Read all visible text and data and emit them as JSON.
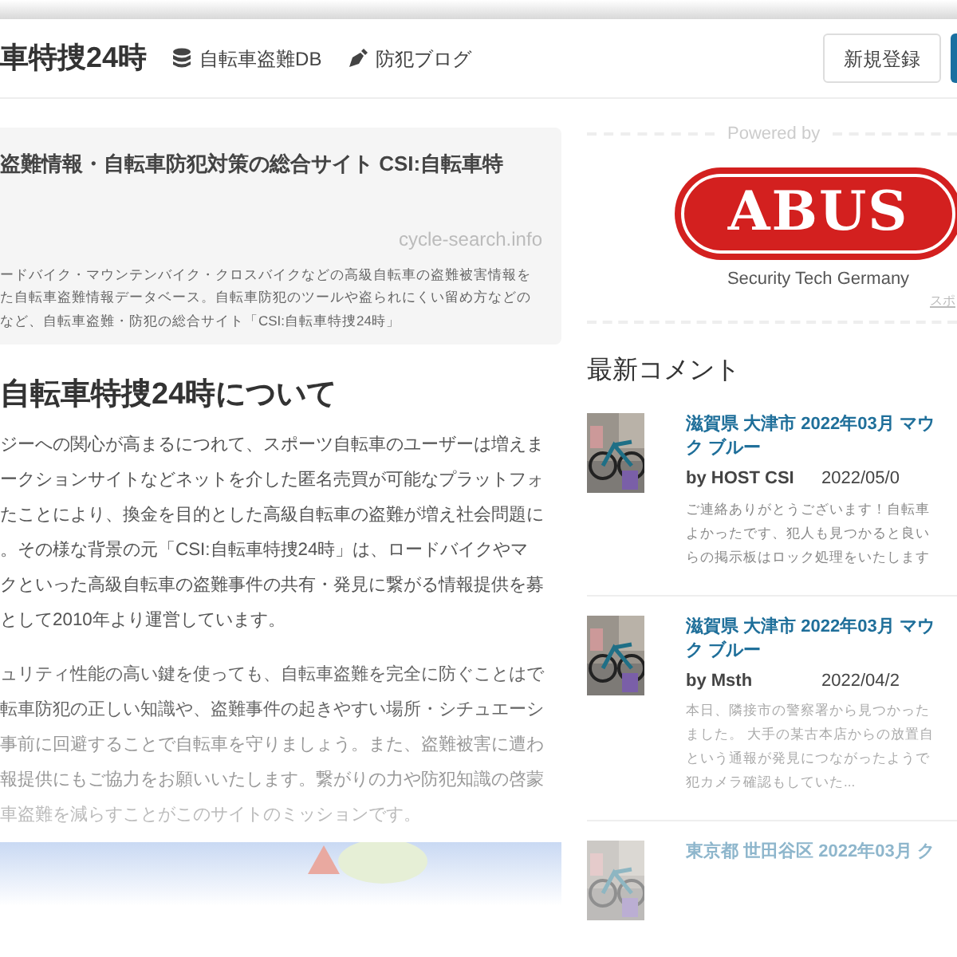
{
  "header": {
    "site_title": "車特捜24時",
    "nav": [
      {
        "kind": "database",
        "label": "自転車盗難DB"
      },
      {
        "kind": "pen",
        "label": "防犯ブログ"
      }
    ],
    "register_button": "新規登録"
  },
  "summary": {
    "title": "盗難情報・自転車防犯対策の総合サイト CSI:自転車特",
    "domain": "cycle-search.info",
    "description_lines": [
      "ードバイク・マウンテンバイク・クロスバイクなどの高級自転車の盗難被害情報を",
      "た自転車盗難情報データベース。自転車防犯のツールや盗られにくい留め方などの",
      "など、自転車盗難・防犯の総合サイト「CSI:自転車特捜24時」"
    ]
  },
  "about": {
    "heading": "自転車特捜24時について",
    "paragraphs": [
      [
        "ジーへの関心が高まるにつれて、スポーツ自転車のユーザーは増えま",
        "ークションサイトなどネットを介した匿名売買が可能なプラットフォ",
        "たことにより、換金を目的とした高級自転車の盗難が増え社会問題に",
        "。その様な背景の元「CSI:自転車特捜24時」は、ロードバイクやマ",
        "クといった高級自転車の盗難事件の共有・発見に繋がる情報提供を募",
        "として2010年より運営しています。"
      ],
      [
        "ュリティ性能の高い鍵を使っても、自転車盗難を完全に防ぐことはで",
        "転車防犯の正しい知識や、盗難事件の起きやすい場所・シチュエーシ",
        "事前に回避することで自転車を守りましょう。また、盗難被害に遭わ",
        "報提供にもご協力をお願いいたします。繋がりの力や防犯知識の啓蒙",
        "車盗難を減らすことがこのサイトのミッションです。"
      ]
    ]
  },
  "sponsor": {
    "label": "Powered by",
    "logo_text": "ABUS",
    "tagline": "Security Tech Germany",
    "note": "スポ"
  },
  "recent_comments": {
    "heading": "最新コメント",
    "items": [
      {
        "title_lines": [
          "滋賀県 大津市 2022年03月 マウ",
          "ク ブルー"
        ],
        "author": "by HOST CSI",
        "date": "2022/05/0",
        "excerpt_lines": [
          "ご連絡ありがとうございます！自転車",
          "よかったです、犯人も見つかると良い",
          "らの掲示板はロック処理をいたします"
        ],
        "faded": false
      },
      {
        "title_lines": [
          "滋賀県 大津市 2022年03月 マウ",
          "ク ブルー"
        ],
        "author": "by Msth",
        "date": "2022/04/2",
        "excerpt_lines": [
          "本日、隣接市の警察署から見つかった",
          "ました。 大手の某古本店からの放置自",
          "という通報が発見につながったようで",
          "犯カメラ確認もしていた..."
        ],
        "faded": false
      },
      {
        "title_lines": [
          "東京都 世田谷区 2022年03月 ク"
        ],
        "faded": true
      }
    ]
  }
}
